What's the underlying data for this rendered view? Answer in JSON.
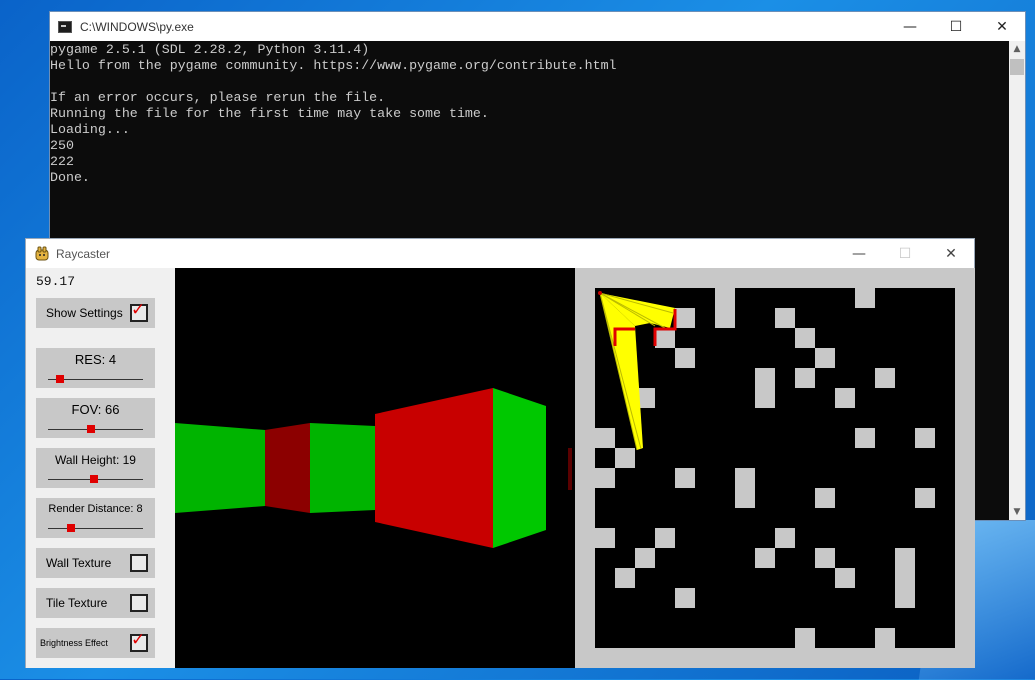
{
  "console": {
    "title": "C:\\WINDOWS\\py.exe",
    "buttons": {
      "minimize": "—",
      "maximize": "☐",
      "close": "✕"
    },
    "lines": [
      "pygame 2.5.1 (SDL 2.28.2, Python 3.11.4)",
      "Hello from the pygame community. https://www.pygame.org/contribute.html",
      "",
      "If an error occurs, please rerun the file.",
      "Running the file for the first time may take some time.",
      "Loading...",
      "250",
      "222",
      "Done."
    ]
  },
  "raycaster": {
    "title": "Raycaster",
    "buttons": {
      "minimize": "—",
      "maximize": "☐",
      "close": "✕"
    },
    "fps": "59.17",
    "settings": {
      "show_settings": {
        "label": "Show Settings",
        "checked": true
      },
      "res": {
        "label": "RES: 4",
        "level": 0.13
      },
      "fov": {
        "label": "FOV: 66",
        "level": 0.45
      },
      "wall_height": {
        "label": "Wall Height: 19",
        "level": 0.48
      },
      "render_distance": {
        "label": "Render Distance: 8",
        "level": 0.24
      },
      "wall_texture": {
        "label": "Wall Texture",
        "checked": false
      },
      "tile_texture": {
        "label": "Tile Texture",
        "checked": false
      },
      "brightness_effect": {
        "label": "Brightness Effect",
        "checked": true
      }
    },
    "check_glyph": "✓",
    "colors": {
      "wall_red": "#c80000",
      "wall_red_dark": "#8c0000",
      "wall_green": "#00b400",
      "wall_green_light": "#00c800",
      "minimap_wall": "#c8c8c8",
      "minimap_floor": "#000000",
      "ray_yellow": "#ffff00",
      "knob_red": "#e00000"
    }
  }
}
